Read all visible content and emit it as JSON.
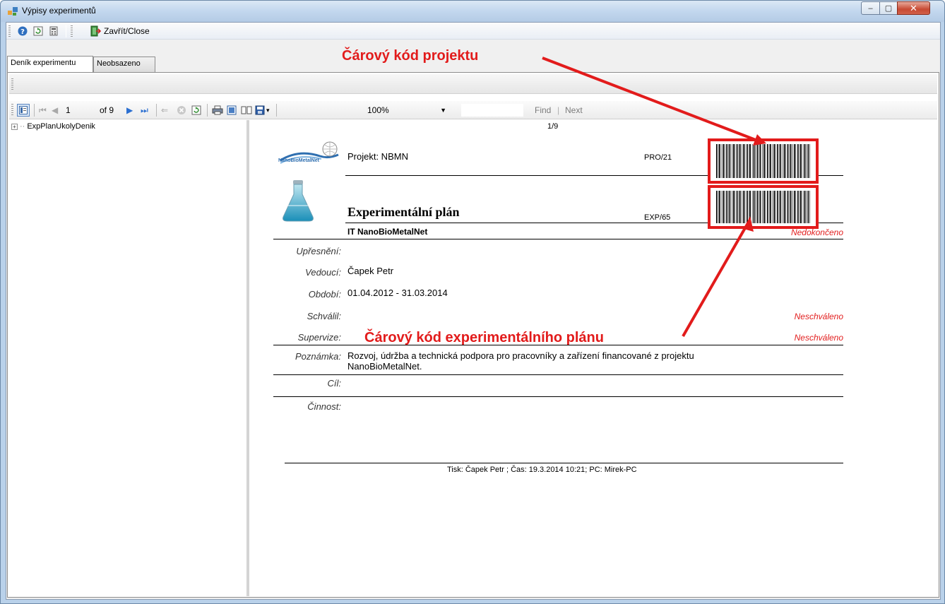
{
  "window": {
    "title": "Výpisy experimentů",
    "min_glyph": "‒",
    "max_glyph": "▢",
    "close_glyph": "✕"
  },
  "toolbar": {
    "close_label": "Zavřít/Close"
  },
  "tabs": [
    {
      "label": "Deník experimentu"
    },
    {
      "label": "Neobsazeno"
    }
  ],
  "report_toolbar": {
    "page": "1",
    "of_pages": "of 9",
    "zoom": "100%",
    "find": "Find",
    "find_sep": "|",
    "next": "Next"
  },
  "document_map": {
    "root": "ExpPlanUkolyDenik"
  },
  "report": {
    "page_indicator": "1/9",
    "logo_text": "NanoBioMetalNet",
    "project": "Projekt: NBMN",
    "project_code": "PRO/21",
    "title": "Experimentální plán",
    "exp_code": "EXP/65",
    "subtitle": "IT NanoBioMetalNet",
    "status": "Nedokončeno",
    "fields": {
      "upresneni_label": "Upřesnění:",
      "vedouci_label": "Vedoucí:",
      "vedouci_value": "Čapek Petr",
      "obdobi_label": "Období:",
      "obdobi_value": "01.04.2012  -  31.03.2014",
      "schvalil_label": "Schválil:",
      "schvalil_value": "Neschváleno",
      "supervize_label": "Supervize:",
      "supervize_value": "Neschváleno",
      "poznamka_label": "Poznámka:",
      "poznamka_line1": "Rozvoj, údržba a technická podpora pro pracovníky a zařízení financované z projektu",
      "poznamka_line2": "NanoBioMetalNet.",
      "cil_label": "Cíl:",
      "cinnost_label": "Činnost:"
    },
    "footer": "Tisk: Čapek Petr ; Čas: 19.3.2014  10:21; PC: Mirek-PC"
  },
  "annotations": {
    "project_barcode": "Čárový kód projektu",
    "plan_barcode": "Čárový kód experimentálního plánu",
    "color": "#e21b1b"
  }
}
